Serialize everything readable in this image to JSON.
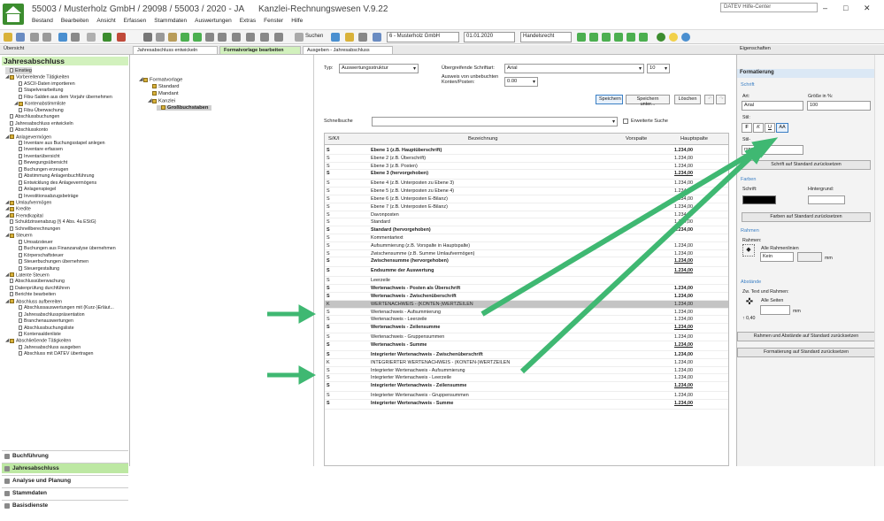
{
  "window": {
    "title": "55003 / Musterholz GmbH / 29098 / 55003 / 2020 - JA",
    "program": "Kanzlei-Rechnungswesen V.9.22",
    "help": "DATEV Hilfe-Center"
  },
  "menu": [
    "Bestand",
    "Bearbeiten",
    "Ansicht",
    "Erfassen",
    "Stammdaten",
    "Auswertungen",
    "Extras",
    "Fenster",
    "Hilfe"
  ],
  "toolbar": {
    "search": "Suchen",
    "client": "6 - Musterholz GmbH",
    "date": "01.01.2020",
    "law": "Handelsrecht"
  },
  "tabs": {
    "overview": "Übersicht",
    "t1": "Jahresabschluss entwickeln",
    "t2": "Formatvorlage bearbeiten",
    "t3": "Ausgeben - Jahresabschluss",
    "props": "Eigenschaften"
  },
  "left": {
    "header": "Jahresabschluss",
    "items": [
      "Einstieg",
      "Vorbereitende Tätigkeiten",
      "ASCII-Daten importieren",
      "Stapelverarbeitung",
      "Fibu-Salden aus dem Vorjahr übernehmen",
      "Kontenabstimmliste",
      "Fibu-Überwachung",
      "Abschlussbuchungen",
      "Jahresabschluss entwickeln",
      "Abschlusskonto",
      "Anlagevermögen",
      "Inventare aus Buchungsstapel anlegen",
      "Inventare erfassen",
      "Inventarübersicht",
      "Bewegungsübersicht",
      "Buchungen erzeugen",
      "Abstimmung Anlagenbuchführung",
      "Entwicklung des Anlagevermögens",
      "Anlagenspiegel",
      "Investitionsabzugsbeträge",
      "Umlaufvermögen",
      "Kredite",
      "Fremdkapital",
      "Schuldzinsenabzug (§ 4 Abs. 4a EStG)",
      "Schnellberechnungen",
      "Steuern",
      "Umsatzsteuer",
      "Buchungen aus Finanzanalyse übernehmen",
      "Körperschaftsteuer",
      "Steuerbuchungen übernehmen",
      "Steuergestaltung",
      "Latente Steuern",
      "Abschlussüberwachung",
      "Datenprüfung durchführen",
      "Berichte bearbeiten",
      "Abschluss aufbereiten",
      "Abschlussauswertungen mit (Kurz-)Erläut...",
      "Jahresabschlusspräsentation",
      "Branchenauswertungen",
      "Abschlussbuchungsliste",
      "Kontensaldenliste",
      "Abschließende Tätigkeiten",
      "Jahresabschluss ausgeben",
      "Abschluss mit DATEV übertragen"
    ],
    "nav": [
      "Buchführung",
      "Jahresabschluss",
      "Analyse und Planung",
      "Stammdaten",
      "Basisdienste"
    ]
  },
  "tree": [
    "Formatvorlage",
    "Standard",
    "Mandant",
    "Kanzlei",
    "Großbuchstaben"
  ],
  "form": {
    "typ_label": "Typ:",
    "typ": "Auswertungsstruktur",
    "font_label": "Übergreifende Schriftart:",
    "font": "Arial",
    "size": "10",
    "ausweis_label": "Ausweis von unbebuchten Konten/Posten:",
    "ausweis": "0.00",
    "save": "Speichern",
    "save_as": "Speichern unter...",
    "delete": "Löschen",
    "search_label": "Schnellsuche",
    "extended": "Erweiterte Suche"
  },
  "grid": {
    "headers": [
      "S/K/I",
      "Bezeichnung",
      "Vorspalte",
      "Hauptspalte"
    ],
    "rows": [
      [
        "S",
        "Ebene 1 (z.B. Hauptüberschrift)",
        "",
        "1.234,00",
        "b"
      ],
      [
        "S",
        "Ebene 2 (z.B. Überschrift)",
        "",
        "1.234,00",
        ""
      ],
      [
        "S",
        "Ebene 3 (z.B. Posten)",
        "",
        "1.234,00",
        ""
      ],
      [
        "S",
        "Ebene 3 (hervorgehoben)",
        "",
        "1.234,00",
        "bu"
      ],
      [
        "S",
        "Ebene 4 (z.B. Unterposten zu Ebene 3)",
        "",
        "1.234,00",
        ""
      ],
      [
        "S",
        "Ebene 5 (z.B. Unterposten zu Ebene 4)",
        "",
        "1.234,00",
        ""
      ],
      [
        "S",
        "Ebene 6 (z.B. Unterposten E-Bilanz)",
        "",
        "1.234,00",
        ""
      ],
      [
        "S",
        "Ebene 7 (z.B. Unterposten E-Bilanz)",
        "",
        "1.234,00",
        ""
      ],
      [
        "S",
        "Davonposten",
        "",
        "1.234,00",
        ""
      ],
      [
        "S",
        "Standard",
        "",
        "1.234,00",
        ""
      ],
      [
        "S",
        "Standard (hervorgehoben)",
        "",
        "1.234,00",
        "b"
      ],
      [
        "S",
        "Kommentartext",
        "",
        "",
        ""
      ],
      [
        "S",
        "Aufsummierung (z.B. Vorspalte in Hauptspalte)",
        "",
        "1.234,00",
        ""
      ],
      [
        "S",
        "Zwischensumme (z.B. Summe Umlaufvermögen)",
        "",
        "1.234,00",
        ""
      ],
      [
        "S",
        "Zwischensumme (hervorgehoben)",
        "",
        "1.234,00",
        "bu"
      ],
      [
        "S",
        "Endsumme der Auswertung",
        "",
        "1.234,00",
        "bu"
      ],
      [
        "S",
        "Leerzeile",
        "",
        "",
        ""
      ],
      [
        "S",
        "Wertenachweis - Posten als Überschrift",
        "",
        "1.234,00",
        "b"
      ],
      [
        "S",
        "Wertenachweis - Zwischenüberschrift",
        "",
        "1.234,00",
        "b"
      ],
      [
        "K",
        "WERTENACHWEIS - (KONTEN-)WERTZEILEN",
        "",
        "1.234,00",
        "h"
      ],
      [
        "S",
        "Wertenachweis - Aufsummierung",
        "",
        "1.234,00",
        ""
      ],
      [
        "S",
        "Wertenachweis - Leerzeile",
        "",
        "1.234,00",
        ""
      ],
      [
        "S",
        "Wertenachweis - Zeilensumme",
        "",
        "1.234,00",
        "bu"
      ],
      [
        "S",
        "Wertenachweis - Gruppensummen",
        "",
        "1.234,00",
        ""
      ],
      [
        "S",
        "Wertenachweis - Summe",
        "",
        "1.234,00",
        "bu"
      ],
      [
        "S",
        "Integrierter Wertenachweis - Zwischenüberschrift",
        "",
        "1.234,00",
        "b"
      ],
      [
        "K",
        "INTEGRIERTER WERTENACHWEIS - (KONTEN-)WERTZEILEN",
        "",
        "1.234,00",
        ""
      ],
      [
        "S",
        "Integrierter Wertenachweis - Aufsummierung",
        "",
        "1.234,00",
        ""
      ],
      [
        "S",
        "Integrierter Wertenachweis - Leerzeile",
        "",
        "1.234,00",
        ""
      ],
      [
        "S",
        "Integrierter Wertenachweis - Zeilensumme",
        "",
        "1.234,00",
        "bu"
      ],
      [
        "S",
        "Integrierter Wertenachweis - Gruppensummen",
        "",
        "1.234,00",
        ""
      ],
      [
        "S",
        "Integrierter Wertenachweis - Summe",
        "",
        "1.234,00",
        "bu"
      ]
    ]
  },
  "right": {
    "section": "Formatierung",
    "schrift": "Schrift",
    "art": "Art:",
    "groesse": "Größe in %:",
    "font": "Arial",
    "pct": "100",
    "stil": "Stil:",
    "f": "F",
    "k": "K",
    "u": "U",
    "aa": "AA",
    "stilx": "Stil-",
    "stil_val": "rspalte",
    "reset_font": "Schrift auf Standard zurücksetzen",
    "farben": "Farben",
    "schrift_c": "Schrift:",
    "hinter": "Hintergrund:",
    "reset_color": "Farben auf Standard zurücksetzen",
    "rahmen": "Rahmen",
    "rahmen_l": "Rahmen:",
    "alle_rl": "Alle Rahmenlinien",
    "kein": "Kein",
    "mm": "mm",
    "abstaende": "Abstände",
    "abst_l": "Zw. Text und Rahmen:",
    "alle_s": "Alle Seiten",
    "mm2": "mm",
    "val": "↑ 0,40",
    "reset_ra": "Rahmen und Abstände auf Standard zurücksetzen",
    "reset_fmt": "Formatierung auf Standard zurücksetzen"
  },
  "colors": {
    "accent": "#3fb872",
    "green": "#d2f1bd"
  }
}
